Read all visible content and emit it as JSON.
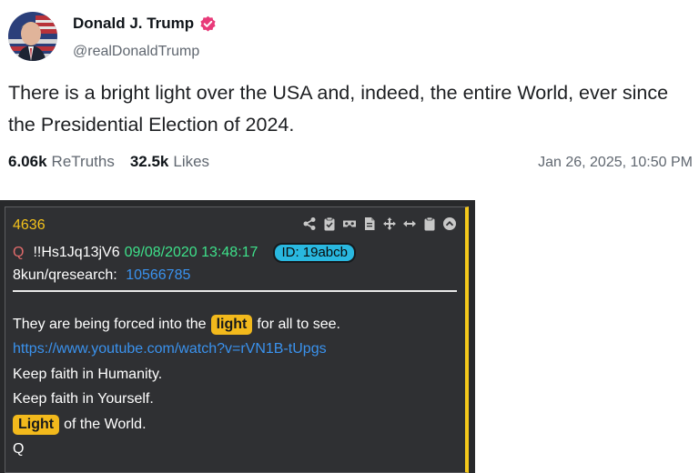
{
  "post": {
    "display_name": "Donald J. Trump",
    "handle": "@realDonaldTrump",
    "text": "There is a bright light over the USA and, indeed, the entire World, ever since the Presidential Election of 2024.",
    "retruths_count": "6.06k",
    "retruths_label": "ReTruths",
    "likes_count": "32.5k",
    "likes_label": "Likes",
    "timestamp": "Jan 26, 2025, 10:50 PM",
    "verified_color": "#e83a79"
  },
  "qdrop": {
    "number": "4636",
    "q_letter": "Q",
    "tripcode": "!!Hs1Jq13jV6",
    "datetime": "09/08/2020 13:48:17",
    "id_badge": "ID: 19abcb",
    "board": "8kun/qresearch:",
    "post_ref": "10566785",
    "line1_before": "They are being forced into the",
    "line1_highlight": "light",
    "line1_after": "for all to see.",
    "link": "https://www.youtube.com/watch?v=rVN1B-tUpgs",
    "line3": "Keep faith in Humanity.",
    "line4": "Keep faith in Yourself.",
    "line5_highlight": "Light",
    "line5_after": "of the World.",
    "signature": "Q",
    "toolbar_icons": [
      "share-icon",
      "clipboard-check-icon",
      "vr-glasses-icon",
      "document-icon",
      "move-icon",
      "resize-horizontal-icon",
      "clipboard-icon",
      "chevron-up-circle-icon"
    ],
    "accent_color": "#f4c81b",
    "highlight_color": "#f2b91c"
  }
}
